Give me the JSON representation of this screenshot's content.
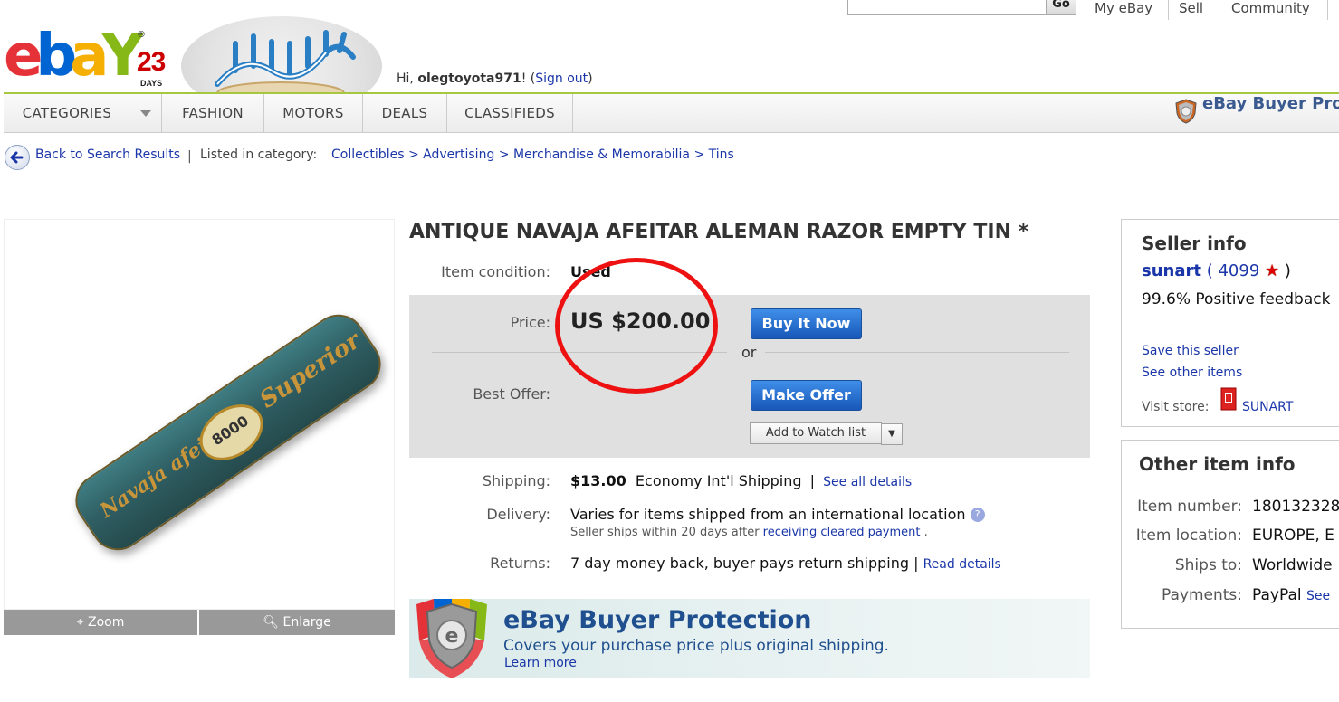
{
  "topbar": {
    "search_value": "",
    "go_label": "Go",
    "nav": [
      "My eBay",
      "Sell",
      "Community"
    ]
  },
  "logo": {
    "letters": [
      "e",
      "b",
      "a",
      "Y"
    ],
    "days_num": "23",
    "days_label": "DAYS",
    "reg": "®"
  },
  "greeting": {
    "prefix": "Hi, ",
    "username": "olegtoyota971",
    "suffix": "! (",
    "signout": "Sign out",
    "close": ")"
  },
  "categories": [
    "CATEGORIES",
    "FASHION",
    "MOTORS",
    "DEALS",
    "CLASSIFIEDS"
  ],
  "header_bp": "eBay Buyer Prot",
  "breadcrumb": {
    "back": "Back to Search Results",
    "sep": "|",
    "listed_in": "Listed in category:",
    "path": [
      "Collectibles",
      "Advertising",
      "Merchandise & Memorabilia",
      "Tins"
    ],
    "arrow": ">"
  },
  "image_tools": {
    "zoom": "Zoom",
    "enlarge": "Enlarge"
  },
  "tin": {
    "number": "8000",
    "text1": "Navaja afeitar",
    "text2": "Superior"
  },
  "item": {
    "title": "ANTIQUE NAVAJA AFEITAR ALEMAN RAZOR EMPTY TIN *",
    "condition_label": "Item condition:",
    "condition": "Used",
    "price_label": "Price:",
    "price": "US $200.00",
    "buy_now": "Buy It Now",
    "or": "or",
    "best_offer_label": "Best Offer:",
    "make_offer": "Make Offer",
    "watch": "Add to Watch list",
    "shipping_label": "Shipping:",
    "shipping_cost": "$13.00",
    "shipping_method": "Economy Int'l Shipping",
    "shipping_sep": "|",
    "shipping_link": "See all details",
    "delivery_label": "Delivery:",
    "delivery": "Varies for items shipped from an international location",
    "delivery_help": "?",
    "delivery_sub_prefix": "Seller ships within 20 days after ",
    "delivery_sub_link": "receiving cleared payment",
    "delivery_sub_suffix": " .",
    "returns_label": "Returns:",
    "returns": "7 day money back, buyer pays return shipping",
    "returns_sep": "|",
    "returns_link": "Read details"
  },
  "protection": {
    "title": "eBay Buyer Protection",
    "subtitle": "Covers your purchase price plus original shipping.",
    "learn": "Learn more"
  },
  "seller": {
    "heading": "Seller info",
    "name": "sunart",
    "open": " (",
    "score": "4099",
    "close": ")",
    "feedback": "99.6% Positive feedback",
    "save": "Save this seller",
    "other": "See other items",
    "visit_label": "Visit store:",
    "store": "SUNART"
  },
  "other_info": {
    "heading": "Other item info",
    "rows": [
      {
        "label": "Item number:",
        "value": "180132328"
      },
      {
        "label": "Item location:",
        "value": "EUROPE, E"
      },
      {
        "label": "Ships to:",
        "value": "Worldwide"
      },
      {
        "label": "Payments:",
        "value": "PayPal"
      }
    ],
    "payments_link": "See"
  },
  "colors": {
    "link": "#1a36a8",
    "accent_green": "#a6c73f",
    "button_blue": "#1757b8",
    "highlight_red": "#ee1111"
  }
}
